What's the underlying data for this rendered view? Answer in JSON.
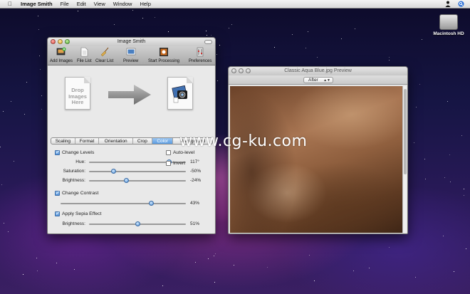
{
  "menubar": {
    "apple_icon": "apple-logo-icon",
    "app_name": "Image Smith",
    "menus": [
      "File",
      "Edit",
      "View",
      "Window",
      "Help"
    ],
    "right_icons": [
      "user-icon",
      "spotlight-search-icon"
    ]
  },
  "desktop": {
    "drive_icon": "hard-drive-icon",
    "drive_label": "Macintosh HD",
    "watermark": "www.cg-ku.com"
  },
  "main_window": {
    "title": "Image Smith",
    "toolbar": [
      {
        "label": "Add Images",
        "icon": "add-images-icon"
      },
      {
        "label": "File List",
        "icon": "file-list-icon"
      },
      {
        "label": "Clear List",
        "icon": "broom-icon"
      },
      {
        "label": "Preview",
        "icon": "preview-icon"
      },
      {
        "label": "Start Processing",
        "icon": "start-processing-icon"
      },
      {
        "label": "Preferences",
        "icon": "preferences-icon"
      }
    ],
    "drop_text": "Drop\nImages\nHere",
    "tabs": [
      "Scaling",
      "Format",
      "Orientation",
      "Crop",
      "Color",
      "Background"
    ],
    "active_tab": "Color",
    "color_panel": {
      "change_levels": {
        "label": "Change Levels",
        "checked": true
      },
      "hue": {
        "label": "Hue:",
        "value": "117°",
        "level": 0.82
      },
      "saturation": {
        "label": "Saturation:",
        "value": "-50%",
        "level": 0.25
      },
      "brightness": {
        "label": "Brightness:",
        "value": "-24%",
        "level": 0.38
      },
      "auto_level": {
        "label": "Auto-level",
        "checked": false
      },
      "invert": {
        "label": "Invert",
        "checked": false
      },
      "change_contrast": {
        "label": "Change Contrast",
        "checked": true
      },
      "contrast": {
        "value": "43%",
        "level": 0.72
      },
      "apply_sepia": {
        "label": "Apply Sepia Effect",
        "checked": true
      },
      "sepia_brightness": {
        "label": "Brightness:",
        "value": "51%",
        "level": 0.5
      }
    }
  },
  "preview_window": {
    "title": "Classic Aqua Blue.jpg Preview",
    "mode": "After"
  }
}
